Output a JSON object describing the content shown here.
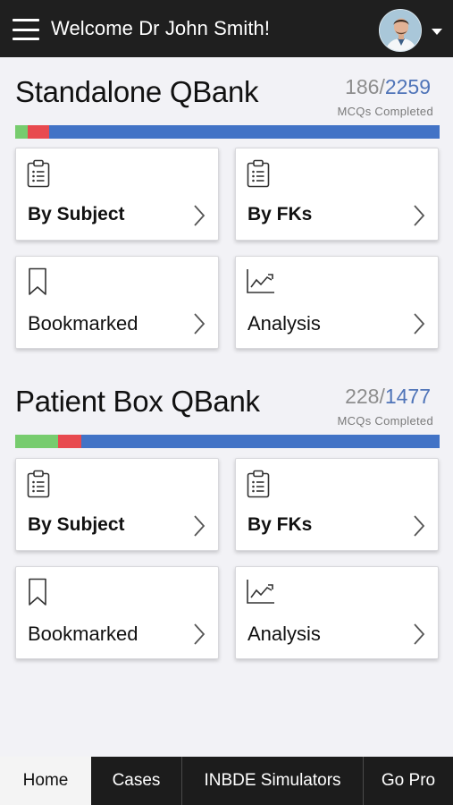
{
  "header": {
    "welcome_text": "Welcome Dr John Smith!",
    "menu_icon": "hamburger-menu-icon",
    "avatar_icon": "user-avatar",
    "dropdown_icon": "caret-down-icon"
  },
  "sections": [
    {
      "title": "Standalone QBank",
      "completed": "186",
      "separator": "/",
      "total": "2259",
      "label": "MCQs Completed",
      "progress": {
        "green_fraction": 0.03,
        "red_fraction": 0.05
      },
      "cards": [
        {
          "label": "By Subject",
          "icon": "clipboard-list-icon"
        },
        {
          "label": "By FKs",
          "icon": "clipboard-list-icon"
        },
        {
          "label": "Bookmarked",
          "icon": "bookmark-icon"
        },
        {
          "label": "Analysis",
          "icon": "trend-chart-icon"
        }
      ]
    },
    {
      "title": "Patient Box QBank",
      "completed": "228",
      "separator": "/",
      "total": "1477",
      "label": "MCQs Completed",
      "progress": {
        "green_fraction": 0.1,
        "red_fraction": 0.055
      },
      "cards": [
        {
          "label": "By Subject",
          "icon": "clipboard-list-icon"
        },
        {
          "label": "By FKs",
          "icon": "clipboard-list-icon"
        },
        {
          "label": "Bookmarked",
          "icon": "bookmark-icon"
        },
        {
          "label": "Analysis",
          "icon": "trend-chart-icon"
        }
      ]
    }
  ],
  "bottom_nav": {
    "tabs": [
      "Home",
      "Cases",
      "INBDE Simulators",
      "Go Pro"
    ],
    "active": "Home"
  },
  "colors": {
    "header_bg": "#1f1f1f",
    "total_blue": "#4f74b8",
    "progress_green": "#77cc6e",
    "progress_red": "#e84a4f",
    "progress_blue": "#4273c6"
  }
}
